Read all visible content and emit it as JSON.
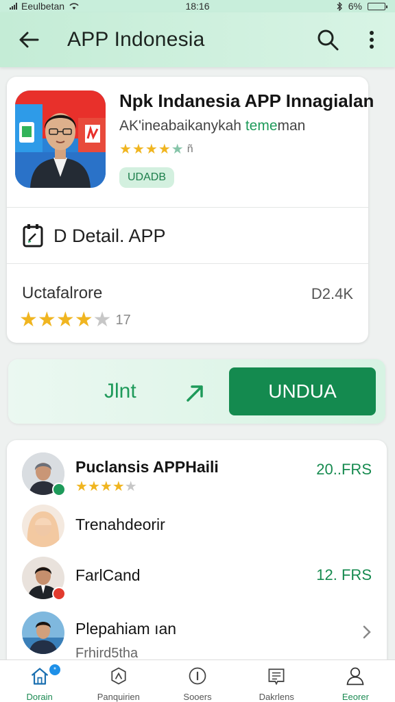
{
  "status_bar": {
    "carrier": "Eeulbetan",
    "time": "18:16",
    "battery": "6%"
  },
  "app_bar": {
    "title": "APP Indonesia"
  },
  "app": {
    "name": "Npk Indanesia APP Innagialan",
    "subtitle_prefix": "AK'ineabaikanykah ",
    "subtitle_highlight": "teme",
    "subtitle_suffix": "man",
    "rating_stars": 4.5,
    "rating_count": "ñ",
    "badge": "UDADB"
  },
  "detail_row": {
    "label": "D Detail. APP"
  },
  "rating_row": {
    "label": "Uctafalrore",
    "value": "D2.4K",
    "rating_stars": 4,
    "rating_count": "17"
  },
  "action": {
    "label": "Jlnt",
    "button_label": "UNDUA"
  },
  "list": {
    "items": [
      {
        "name": "Puclansis APPHaili",
        "price": "20..FRS",
        "rating_stars": 4,
        "badge_color": "#1e9a5a"
      },
      {
        "name": "Trenahdeorir",
        "price": ""
      },
      {
        "name": "FarlCand",
        "price": "12. FRS",
        "badge_color": "#e23b2e"
      },
      {
        "name": "Plepahiam ıan",
        "price": ""
      }
    ],
    "cutoff_text": "Frhird5tha"
  },
  "bottom_nav": {
    "items": [
      {
        "label": "Dorain"
      },
      {
        "label": "Panquirien"
      },
      {
        "label": "Sooers"
      },
      {
        "label": "Dakrlens"
      },
      {
        "label": "Eeorer"
      }
    ],
    "badge": "*"
  },
  "colors": {
    "accent": "#148a4f",
    "appbar": "#c4ecd6",
    "star": "#f0b520"
  }
}
